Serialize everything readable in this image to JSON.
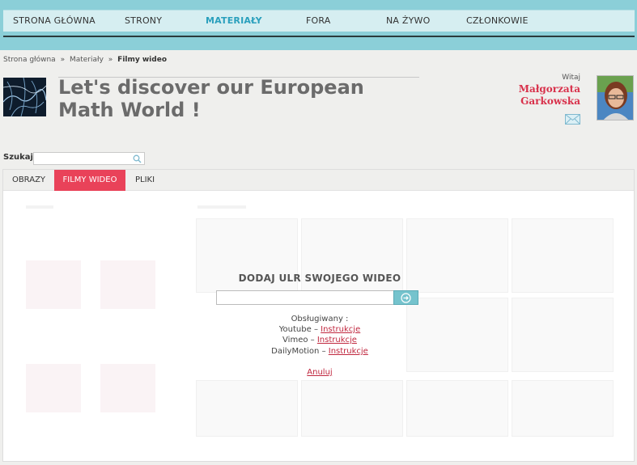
{
  "nav": {
    "items": [
      {
        "label": "STRONA GŁÓWNA"
      },
      {
        "label": "STRONY"
      },
      {
        "label": "MATERIAŁY"
      },
      {
        "label": "FORA"
      },
      {
        "label": "NA ŻYWO"
      },
      {
        "label": "CZŁONKOWIE"
      }
    ],
    "active": "MATERIAŁY"
  },
  "breadcrumb": {
    "home": "Strona główna",
    "sep": "»",
    "section": "Materiały",
    "current": "Filmy wideo"
  },
  "header": {
    "title": "Let's discover our European Math World !",
    "welcome": "Witaj",
    "user_first": "Małgorzata",
    "user_last": "Garkowska"
  },
  "search": {
    "label": "Szukaj",
    "placeholder": ""
  },
  "tabs": [
    {
      "label": "OBRAZY"
    },
    {
      "label": "FILMY WIDEO"
    },
    {
      "label": "PLIKI"
    }
  ],
  "modal": {
    "title": "DODAJ ULR SWOJEGO WIDEO",
    "input_value": "",
    "supported_label": "Obsługiwany :",
    "providers": [
      {
        "name": "Youtube",
        "dash": "–",
        "link": "Instrukcje"
      },
      {
        "name": "Vimeo",
        "dash": "–",
        "link": "Instrukcje"
      },
      {
        "name": "DailyMotion",
        "dash": "–",
        "link": "Instrukcje"
      }
    ],
    "cancel": "Anuluj"
  },
  "colors": {
    "accent": "#e94259",
    "nav_bg": "#8bcfd8",
    "nav_active": "#2aa0bd",
    "user_name": "#d8314b"
  }
}
